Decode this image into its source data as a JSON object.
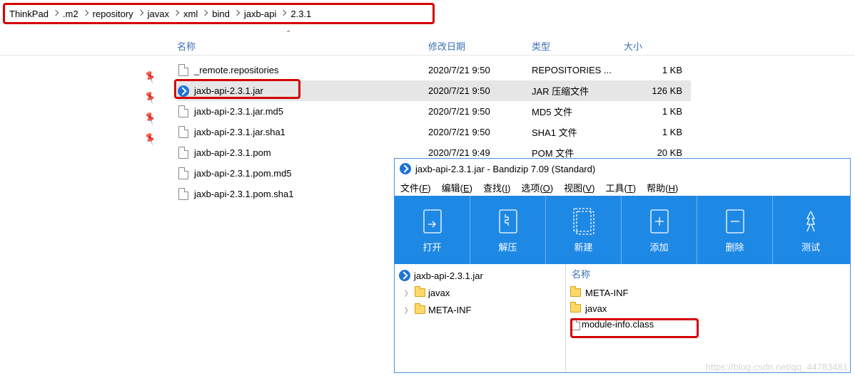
{
  "breadcrumb": [
    "ThinkPad",
    ".m2",
    "repository",
    "javax",
    "xml",
    "bind",
    "jaxb-api",
    "2.3.1"
  ],
  "columns": {
    "name": "名称",
    "date": "修改日期",
    "type": "类型",
    "size": "大小"
  },
  "files": [
    {
      "name": "_remote.repositories",
      "date": "2020/7/21 9:50",
      "type": "REPOSITORIES ...",
      "size": "1 KB",
      "icon": "file",
      "selected": false
    },
    {
      "name": "jaxb-api-2.3.1.jar",
      "date": "2020/7/21 9:50",
      "type": "JAR 压缩文件",
      "size": "126 KB",
      "icon": "jar",
      "selected": true
    },
    {
      "name": "jaxb-api-2.3.1.jar.md5",
      "date": "2020/7/21 9:50",
      "type": "MD5 文件",
      "size": "1 KB",
      "icon": "file",
      "selected": false
    },
    {
      "name": "jaxb-api-2.3.1.jar.sha1",
      "date": "2020/7/21 9:50",
      "type": "SHA1 文件",
      "size": "1 KB",
      "icon": "file",
      "selected": false
    },
    {
      "name": "jaxb-api-2.3.1.pom",
      "date": "2020/7/21 9:49",
      "type": "POM 文件",
      "size": "20 KB",
      "icon": "file",
      "selected": false
    },
    {
      "name": "jaxb-api-2.3.1.pom.md5",
      "date": "",
      "type": "",
      "size": "",
      "icon": "file",
      "selected": false
    },
    {
      "name": "jaxb-api-2.3.1.pom.sha1",
      "date": "",
      "type": "",
      "size": "",
      "icon": "file",
      "selected": false
    }
  ],
  "bandizip": {
    "title": "jaxb-api-2.3.1.jar - Bandizip 7.09 (Standard)",
    "menu": [
      {
        "label": "文件",
        "key": "F"
      },
      {
        "label": "编辑",
        "key": "E"
      },
      {
        "label": "查找",
        "key": "I"
      },
      {
        "label": "选项",
        "key": "O"
      },
      {
        "label": "视图",
        "key": "V"
      },
      {
        "label": "工具",
        "key": "T"
      },
      {
        "label": "帮助",
        "key": "H"
      }
    ],
    "toolbar": [
      "打开",
      "解压",
      "新建",
      "添加",
      "删除",
      "测试"
    ],
    "tree_root": "jaxb-api-2.3.1.jar",
    "tree_children": [
      "javax",
      "META-INF"
    ],
    "list_header": "名称",
    "list": [
      {
        "name": "META-INF",
        "icon": "folder"
      },
      {
        "name": "javax",
        "icon": "folder"
      },
      {
        "name": "module-info.class",
        "icon": "file"
      }
    ]
  },
  "watermark": "https://blog.csdn.net/qq_44783481"
}
